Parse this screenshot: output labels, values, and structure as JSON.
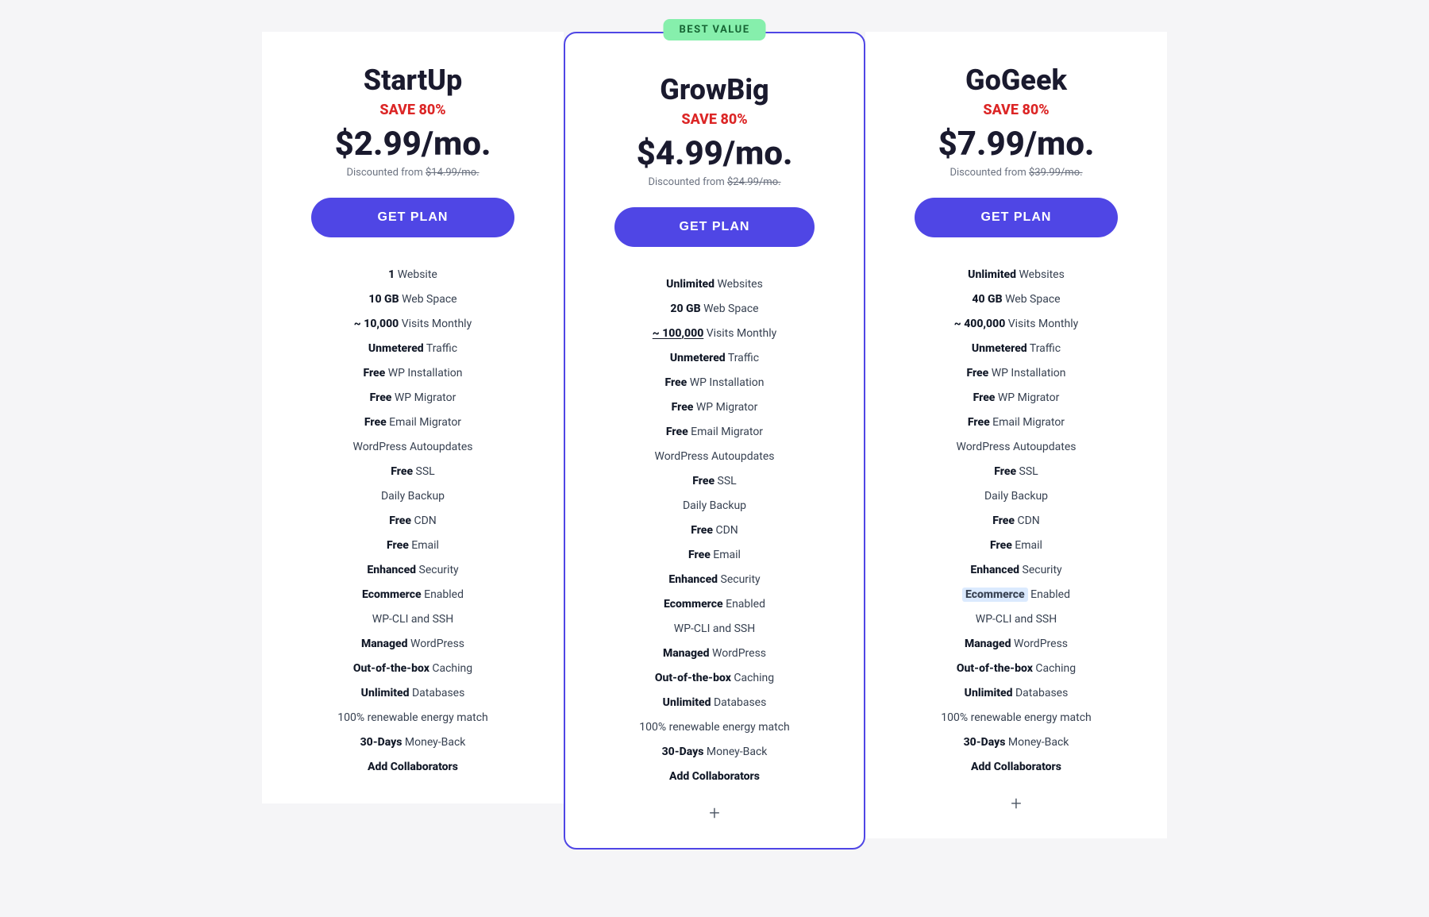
{
  "plans": [
    {
      "id": "startup",
      "name": "StartUp",
      "save": "SAVE 80%",
      "price": "$2.99/mo.",
      "discounted_from": "$14.99/mo.",
      "btn_label": "GET PLAN",
      "featured": false,
      "best_value": false,
      "features": [
        {
          "bold": "1",
          "text": " Website"
        },
        {
          "bold": "10 GB",
          "text": " Web Space"
        },
        {
          "bold": "~ 10,000",
          "text": " Visits Monthly"
        },
        {
          "bold": "Unmetered",
          "text": " Traffic"
        },
        {
          "bold": "Free",
          "text": " WP Installation"
        },
        {
          "bold": "Free",
          "text": " WP Migrator"
        },
        {
          "bold": "Free",
          "text": " Email Migrator"
        },
        {
          "bold": "",
          "text": "WordPress Autoupdates"
        },
        {
          "bold": "Free",
          "text": " SSL"
        },
        {
          "bold": "",
          "text": "Daily Backup"
        },
        {
          "bold": "Free",
          "text": " CDN"
        },
        {
          "bold": "Free",
          "text": " Email"
        },
        {
          "bold": "Enhanced",
          "text": " Security"
        },
        {
          "bold": "Ecommerce",
          "text": " Enabled"
        },
        {
          "bold": "",
          "text": "WP-CLI and SSH"
        },
        {
          "bold": "Managed",
          "text": " WordPress"
        },
        {
          "bold": "Out-of-the-box",
          "text": " Caching"
        },
        {
          "bold": "Unlimited",
          "text": " Databases"
        },
        {
          "bold": "",
          "text": "100% renewable energy match"
        },
        {
          "bold": "30-Days",
          "text": " Money-Back"
        },
        {
          "bold": "Add Collaborators",
          "text": ""
        }
      ],
      "show_plus": false
    },
    {
      "id": "growbig",
      "name": "GrowBig",
      "save": "SAVE 80%",
      "price": "$4.99/mo.",
      "discounted_from": "$24.99/mo.",
      "btn_label": "GET PLAN",
      "featured": true,
      "best_value": true,
      "best_value_label": "BEST VALUE",
      "features": [
        {
          "bold": "Unlimited",
          "text": " Websites"
        },
        {
          "bold": "20 GB",
          "text": " Web Space"
        },
        {
          "bold": "~ 100,000",
          "text": " Visits Monthly",
          "underline": true
        },
        {
          "bold": "Unmetered",
          "text": " Traffic"
        },
        {
          "bold": "Free",
          "text": " WP Installation"
        },
        {
          "bold": "Free",
          "text": " WP Migrator"
        },
        {
          "bold": "Free",
          "text": " Email Migrator"
        },
        {
          "bold": "",
          "text": "WordPress Autoupdates"
        },
        {
          "bold": "Free",
          "text": " SSL"
        },
        {
          "bold": "",
          "text": "Daily Backup"
        },
        {
          "bold": "Free",
          "text": " CDN"
        },
        {
          "bold": "Free",
          "text": " Email"
        },
        {
          "bold": "Enhanced",
          "text": " Security"
        },
        {
          "bold": "Ecommerce",
          "text": " Enabled"
        },
        {
          "bold": "",
          "text": "WP-CLI and SSH"
        },
        {
          "bold": "Managed",
          "text": " WordPress"
        },
        {
          "bold": "Out-of-the-box",
          "text": " Caching"
        },
        {
          "bold": "Unlimited",
          "text": " Databases"
        },
        {
          "bold": "",
          "text": "100% renewable energy match"
        },
        {
          "bold": "30-Days",
          "text": " Money-Back"
        },
        {
          "bold": "Add Collaborators",
          "text": ""
        }
      ],
      "show_plus": true
    },
    {
      "id": "gogeek",
      "name": "GoGeek",
      "save": "SAVE 80%",
      "price": "$7.99/mo.",
      "discounted_from": "$39.99/mo.",
      "btn_label": "GET PLAN",
      "featured": false,
      "best_value": false,
      "features": [
        {
          "bold": "Unlimited",
          "text": " Websites"
        },
        {
          "bold": "40 GB",
          "text": " Web Space"
        },
        {
          "bold": "~ 400,000",
          "text": " Visits Monthly"
        },
        {
          "bold": "Unmetered",
          "text": " Traffic"
        },
        {
          "bold": "Free",
          "text": " WP Installation"
        },
        {
          "bold": "Free",
          "text": " WP Migrator"
        },
        {
          "bold": "Free",
          "text": " Email Migrator"
        },
        {
          "bold": "",
          "text": "WordPress Autoupdates"
        },
        {
          "bold": "Free",
          "text": " SSL"
        },
        {
          "bold": "",
          "text": "Daily Backup"
        },
        {
          "bold": "Free",
          "text": " CDN"
        },
        {
          "bold": "Free",
          "text": " Email"
        },
        {
          "bold": "Enhanced",
          "text": " Security"
        },
        {
          "bold": "Ecommerce",
          "text": " Enabled",
          "highlight": true
        },
        {
          "bold": "",
          "text": "WP-CLI and SSH"
        },
        {
          "bold": "Managed",
          "text": " WordPress"
        },
        {
          "bold": "Out-of-the-box",
          "text": " Caching"
        },
        {
          "bold": "Unlimited",
          "text": " Databases"
        },
        {
          "bold": "",
          "text": "100% renewable energy match"
        },
        {
          "bold": "30-Days",
          "text": " Money-Back"
        },
        {
          "bold": "Add Collaborators",
          "text": ""
        }
      ],
      "show_plus": true
    }
  ]
}
